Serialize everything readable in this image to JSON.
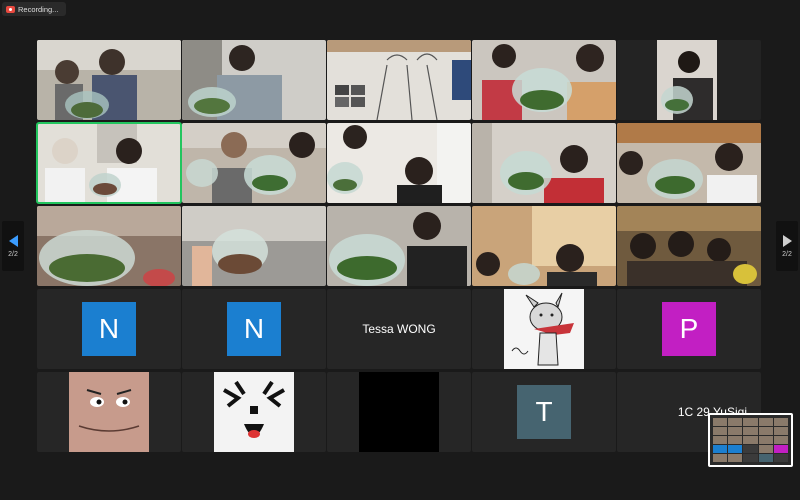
{
  "recording": {
    "label": "Recording..."
  },
  "navigation": {
    "prev_page": "2/2",
    "next_page": "2/2"
  },
  "participants": [
    {
      "kind": "video",
      "scene": "two people holding terrarium"
    },
    {
      "kind": "video",
      "scene": "person holding terrarium"
    },
    {
      "kind": "video",
      "scene": "wall drawing"
    },
    {
      "kind": "video",
      "scene": "child and adult with terrarium"
    },
    {
      "kind": "video",
      "scene": "child with terrarium"
    },
    {
      "kind": "video",
      "scene": "two women peace sign",
      "active": true
    },
    {
      "kind": "video",
      "scene": "people holding terrarium"
    },
    {
      "kind": "video",
      "scene": "girl peace sign with terrarium"
    },
    {
      "kind": "video",
      "scene": "woman with glass bowl terrarium"
    },
    {
      "kind": "video",
      "scene": "two women with terrarium"
    },
    {
      "kind": "video",
      "scene": "hands holding terrarium"
    },
    {
      "kind": "video",
      "scene": "hands holding jar"
    },
    {
      "kind": "video",
      "scene": "woman peace sign terrarium"
    },
    {
      "kind": "video",
      "scene": "boy and woman"
    },
    {
      "kind": "video",
      "scene": "group of children"
    },
    {
      "kind": "initial",
      "initial": "N",
      "color": "#1b7fd0"
    },
    {
      "kind": "initial",
      "initial": "N",
      "color": "#1b7fd0"
    },
    {
      "kind": "name",
      "name": "Tessa WONG"
    },
    {
      "kind": "avatar",
      "avatar": "cartoon-dog"
    },
    {
      "kind": "initial",
      "initial": "P",
      "color": "#c21fc3"
    },
    {
      "kind": "avatar",
      "avatar": "cartoon-face"
    },
    {
      "kind": "avatar",
      "avatar": "cartoon-ghost"
    },
    {
      "kind": "avatar",
      "avatar": "black"
    },
    {
      "kind": "initial",
      "initial": "T",
      "color": "#466470"
    },
    {
      "kind": "name",
      "name": "1C 29 YuSiqi"
    }
  ]
}
